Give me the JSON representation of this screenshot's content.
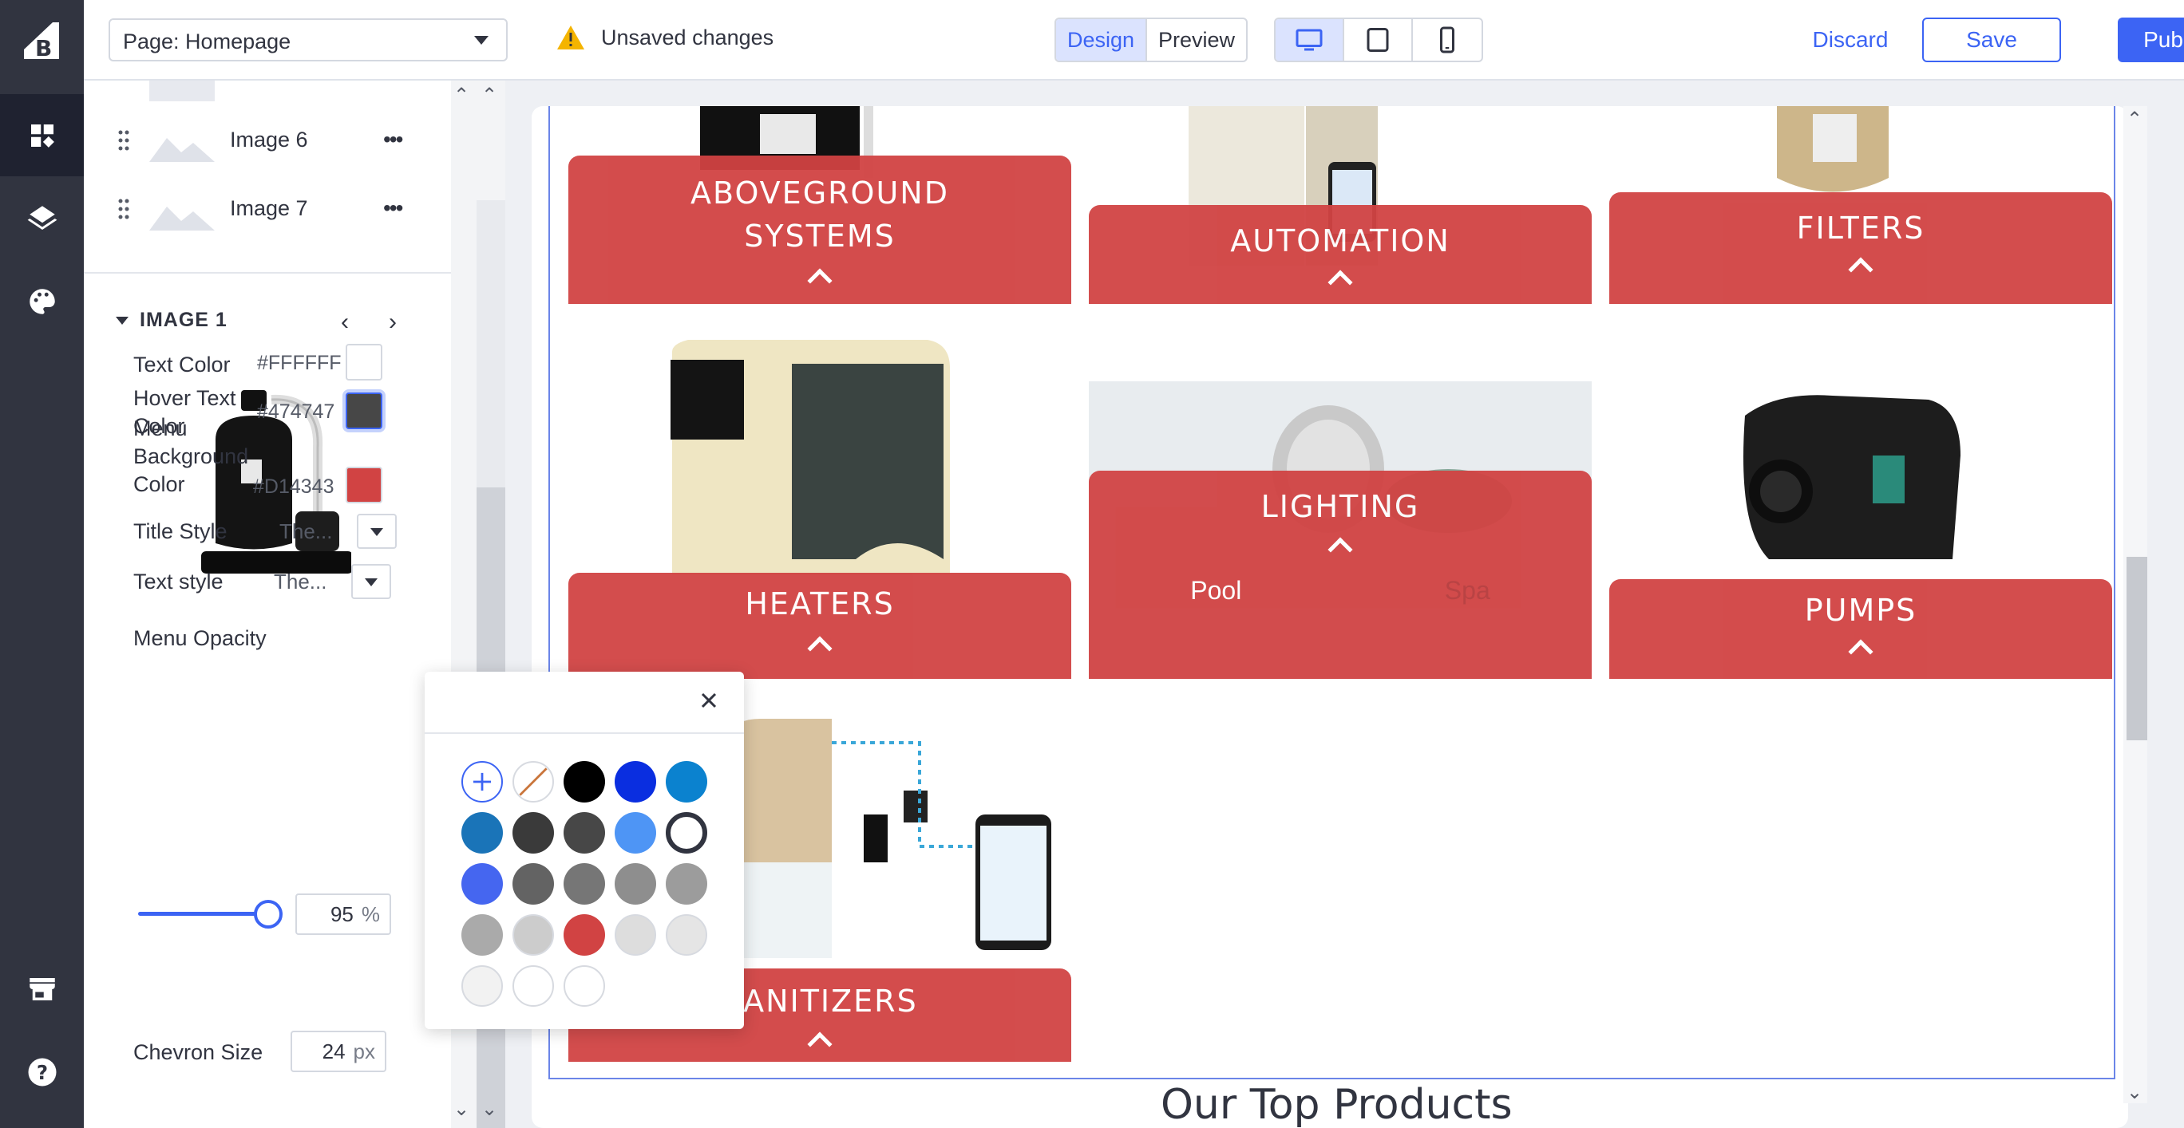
{
  "topbar": {
    "page_select": "Page: Homepage",
    "unsaved": "Unsaved changes",
    "mode_design": "Design",
    "mode_preview": "Preview",
    "discard": "Discard",
    "save": "Save",
    "publish": "Publish"
  },
  "layers": {
    "items": [
      {
        "label": "Image 6"
      },
      {
        "label": "Image 7"
      }
    ]
  },
  "section": {
    "title": "IMAGE 1"
  },
  "props": {
    "text_color": {
      "label": "Text Color",
      "hex": "#FFFFFF"
    },
    "hover_text_color": {
      "label_line1": "Hover Text",
      "label_line2": "Color",
      "hex": "#474747"
    },
    "menu_bg_color": {
      "label_line1": "Menu",
      "label_line2": "Background",
      "label_line3": "Color",
      "hex": "#D14343"
    },
    "title_style": {
      "label": "Title Style",
      "value": "The..."
    },
    "text_style": {
      "label": "Text style",
      "value": "The..."
    },
    "menu_opacity": {
      "label": "Menu Opacity",
      "value": "95",
      "unit": "%",
      "fraction": 0.95
    },
    "chevron_size": {
      "label": "Chevron Size",
      "value": "24",
      "unit": "px"
    }
  },
  "canvas": {
    "tiles": [
      {
        "title_line1": "ABOVEGROUND",
        "title_line2": "SYSTEMS"
      },
      {
        "title": "AUTOMATION"
      },
      {
        "title": "FILTERS"
      },
      {
        "title": "HEATERS"
      },
      {
        "title": "LIGHTING",
        "sub1": "Pool",
        "sub2": "Spa"
      },
      {
        "title": "PUMPS"
      },
      {
        "title": "SANITIZERS"
      }
    ],
    "footer_text": "Our Top Products"
  },
  "picker": {
    "colors": [
      "add",
      "none",
      "#000000",
      "#0a2ee0",
      "#0b82cf",
      "#1a74b8",
      "#3a3a3a",
      "#474747",
      "#4e95f5",
      "ring",
      "#4566f0",
      "#636363",
      "#767676",
      "#8e8e8e",
      "#9c9c9c",
      "#aaaaaa",
      "#cccccc",
      "#d14343",
      "#dddddd",
      "#e5e5e5",
      "#f2f2f2",
      "#ffffff",
      "#ffffff"
    ]
  },
  "colors": {
    "accent": "#3c64f4",
    "menu_bg": "#D14343",
    "rail": "#313440"
  },
  "icons": {
    "rail": [
      "bigcommerce-logo",
      "widgets-icon",
      "layers-icon",
      "palette-icon",
      "storefront-icon",
      "help-icon"
    ],
    "devices": [
      "desktop-icon",
      "tablet-icon",
      "mobile-icon"
    ]
  }
}
